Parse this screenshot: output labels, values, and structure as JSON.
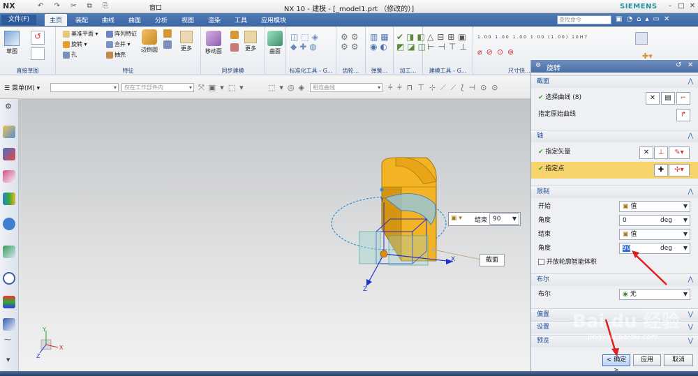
{
  "titlebar": {
    "logo": "NX",
    "quick_access": "↶ ↷ ✂ ⧉ ⎘",
    "window_menu": "窗口",
    "title": "NX 10 - 建模 - [_model1.prt （修改的）]",
    "brand": "SIEMENS"
  },
  "menubar": {
    "file": "文件(F)",
    "tabs": [
      "主页",
      "装配",
      "曲线",
      "曲面",
      "分析",
      "视图",
      "渲染",
      "工具",
      "应用模块"
    ],
    "search_placeholder": "查找命令"
  },
  "ribbon": {
    "groups": [
      "直接草图",
      "特征",
      "同步建模",
      "标准化工具 - G...",
      "齿轮...",
      "弹簧...",
      "加工...",
      "建模工具 - G...",
      "尺寸快..."
    ],
    "sketch": "草图",
    "feature_items": [
      "基准平面",
      "阵列特征",
      "旋转",
      "合并",
      "孔",
      "抽壳"
    ],
    "edge_blend": "边倒圆",
    "more1": "更多",
    "move_face": "移动面",
    "more2": "更多",
    "surface": "曲面",
    "dim_labels": [
      "1.00",
      "1.00",
      "1.00",
      "1.00",
      "(1.00)",
      "10H7"
    ]
  },
  "toolbar": {
    "menu": "菜单(M)",
    "filter_placeholder": "",
    "scope": "仅在工作部件内",
    "curve_rule": "相连曲线"
  },
  "viewport": {
    "end_label": "结束",
    "end_value": "90",
    "section_label": "截面",
    "axes": {
      "x": "X",
      "y": "Y",
      "z": "Z"
    }
  },
  "dialog": {
    "title": "旋转",
    "section": {
      "header": "截面",
      "select_curve": "选择曲线 (8)",
      "origin_curve": "指定原始曲线"
    },
    "axis": {
      "header": "轴",
      "vector": "指定矢量",
      "point": "指定点"
    },
    "limits": {
      "header": "限制",
      "start": "开始",
      "start_mode": "值",
      "angle1": "角度",
      "angle1_value": "0",
      "unit1": "deg",
      "end": "结束",
      "end_mode": "值",
      "angle2": "角度",
      "angle2_value": "90",
      "unit2": "deg",
      "open_profile": "开放轮廓智能体积"
    },
    "boolean": {
      "header": "布尔",
      "label": "布尔",
      "value": "无"
    },
    "offset": {
      "header": "偏置"
    },
    "settings": {
      "header": "设置"
    },
    "preview": {
      "header": "预览"
    },
    "ok": "< 确定 >",
    "apply": "应用",
    "cancel": "取消"
  },
  "watermark": {
    "brand": "Bai du 经验",
    "url": "jingyan.baidu.com"
  },
  "colors": {
    "accent": "#3d67a5",
    "part": "#f2b11e",
    "arrow": "#e02020"
  }
}
